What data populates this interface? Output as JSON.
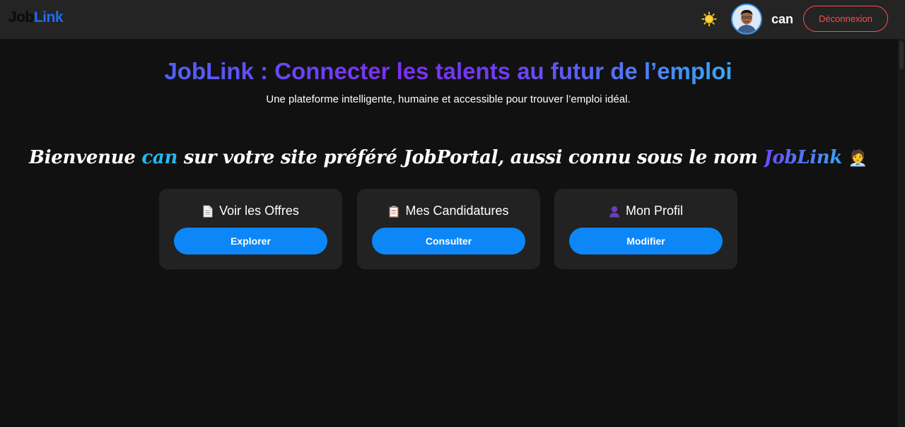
{
  "navbar": {
    "brand_part1": "Job",
    "brand_part2": "Link",
    "theme_icon": "sun-icon",
    "username": "can",
    "logout_label": "Déconnexion"
  },
  "hero": {
    "title": "JobLink : Connecter les talents au futur de l’emploi",
    "subtitle": "Une plateforme intelligente, humaine et accessible pour trouver l’emploi idéal."
  },
  "welcome": {
    "part1": "Bienvenue ",
    "username": "can",
    "part2": " sur votre site préféré JobPortal, aussi connu sous le nom ",
    "brand": "JobLink",
    "emoji": "🧑‍💼"
  },
  "cards": [
    {
      "icon": "document-icon",
      "title": "Voir les Offres",
      "button": "Explorer"
    },
    {
      "icon": "clipboard-icon",
      "title": "Mes Candidatures",
      "button": "Consulter"
    },
    {
      "icon": "person-icon",
      "title": "Mon Profil",
      "button": "Modifier"
    }
  ],
  "colors": {
    "background": "#121112",
    "navbar": "#242424",
    "card": "#232223",
    "accent_button": "#0d87f7",
    "logout": "#ff4d4d",
    "brand_blue": "#1d6cf2"
  }
}
